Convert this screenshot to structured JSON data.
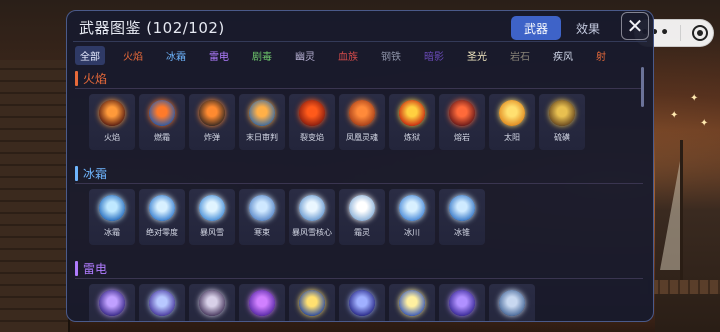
{
  "panel": {
    "title": "武器图鉴 (102/102)",
    "tabs": [
      {
        "label": "武器",
        "active": true
      },
      {
        "label": "效果",
        "active": false
      }
    ],
    "close_glyph": "✕"
  },
  "capsule": {
    "more_glyph": "•••"
  },
  "filters": [
    {
      "label": "全部",
      "color": "#e8ecff",
      "active": true
    },
    {
      "label": "火焰",
      "color": "#e86a3a"
    },
    {
      "label": "冰霜",
      "color": "#6fb6ff"
    },
    {
      "label": "雷电",
      "color": "#b07cff"
    },
    {
      "label": "剧毒",
      "color": "#6cc46a"
    },
    {
      "label": "幽灵",
      "color": "#b9b3d6"
    },
    {
      "label": "血族",
      "color": "#d24a4a"
    },
    {
      "label": "钢铁",
      "color": "#8d93a8"
    },
    {
      "label": "暗影",
      "color": "#6a4ab8"
    },
    {
      "label": "圣光",
      "color": "#f0e6c0"
    },
    {
      "label": "岩石",
      "color": "#8a8478"
    },
    {
      "label": "疾风",
      "color": "#cfd6e8"
    },
    {
      "label": "射",
      "color": "#e86a3a"
    }
  ],
  "sections": [
    {
      "title": "火焰",
      "color": "#e86a3a",
      "items": [
        {
          "name": "火焰",
          "icon": "fire-icon",
          "c1": "#ff9a3a",
          "c2": "#5a1e12"
        },
        {
          "name": "燃霜",
          "icon": "frostfire-icon",
          "c1": "#ff7a2a",
          "c2": "#2a5aa8"
        },
        {
          "name": "炸弹",
          "icon": "bomb-icon",
          "c1": "#ff8a30",
          "c2": "#3a2a22"
        },
        {
          "name": "末日审判",
          "icon": "doom-icon",
          "c1": "#ffb048",
          "c2": "#3a6aa0"
        },
        {
          "name": "裂变焰",
          "icon": "fission-flame-icon",
          "c1": "#ff5a1a",
          "c2": "#8a1e10"
        },
        {
          "name": "凤凰灵魂",
          "icon": "phoenix-icon",
          "c1": "#ff8a3a",
          "c2": "#a8401a"
        },
        {
          "name": "炼狱",
          "icon": "inferno-icon",
          "c1": "#ffd040",
          "c2": "#c82a10"
        },
        {
          "name": "熔岩",
          "icon": "lava-icon",
          "c1": "#ff6a3a",
          "c2": "#6a1a1a"
        },
        {
          "name": "太阳",
          "icon": "sun-icon",
          "c1": "#ffe070",
          "c2": "#e08a20"
        },
        {
          "name": "硫磺",
          "icon": "sulfur-icon",
          "c1": "#e8c050",
          "c2": "#6a4a20"
        }
      ]
    },
    {
      "title": "冰霜",
      "color": "#6fb6ff",
      "items": [
        {
          "name": "冰霜",
          "icon": "frost-icon",
          "c1": "#bfe8ff",
          "c2": "#2a70c0"
        },
        {
          "name": "绝对零度",
          "icon": "absolute-zero-icon",
          "c1": "#d8f0ff",
          "c2": "#3a80d0"
        },
        {
          "name": "暴风雪",
          "icon": "blizzard-icon",
          "c1": "#e0f4ff",
          "c2": "#4a90d8"
        },
        {
          "name": "寒束",
          "icon": "cold-beam-icon",
          "c1": "#cfe8ff",
          "c2": "#5a88c8"
        },
        {
          "name": "暴风雪核心",
          "icon": "blizzard-core-icon",
          "c1": "#eaf6ff",
          "c2": "#6a9ad0"
        },
        {
          "name": "霜灵",
          "icon": "frost-spirit-icon",
          "c1": "#ffffff",
          "c2": "#8ab0d8"
        },
        {
          "name": "冰川",
          "icon": "glacier-icon",
          "c1": "#d8f0ff",
          "c2": "#4a8ad8"
        },
        {
          "name": "冰锥",
          "icon": "icicle-icon",
          "c1": "#cfeaff",
          "c2": "#3a7ac8"
        }
      ]
    },
    {
      "title": "雷电",
      "color": "#b07cff",
      "items": [
        {
          "name": "",
          "icon": "thunder-icon",
          "c1": "#c0a0ff",
          "c2": "#3a2a8a"
        },
        {
          "name": "",
          "icon": "thunder-wings-icon",
          "c1": "#b8c8ff",
          "c2": "#4a3aa0"
        },
        {
          "name": "",
          "icon": "thunder-orb-icon",
          "c1": "#d8d0e8",
          "c2": "#4a3a60"
        },
        {
          "name": "",
          "icon": "thunder-rune-icon",
          "c1": "#d080ff",
          "c2": "#5a2aa8"
        },
        {
          "name": "",
          "icon": "thunder-sun-icon",
          "c1": "#ffe070",
          "c2": "#2a4aa0"
        },
        {
          "name": "",
          "icon": "thunder-sphere-icon",
          "c1": "#a0b0ff",
          "c2": "#2a2a8a"
        },
        {
          "name": "",
          "icon": "thunder-star-icon",
          "c1": "#fff0a0",
          "c2": "#3a5ab8"
        },
        {
          "name": "",
          "icon": "thunder-vortex-icon",
          "c1": "#b090ff",
          "c2": "#3a2a98"
        },
        {
          "name": "",
          "icon": "thunder-stone-icon",
          "c1": "#c8d8f0",
          "c2": "#4a6a9a"
        }
      ]
    }
  ]
}
